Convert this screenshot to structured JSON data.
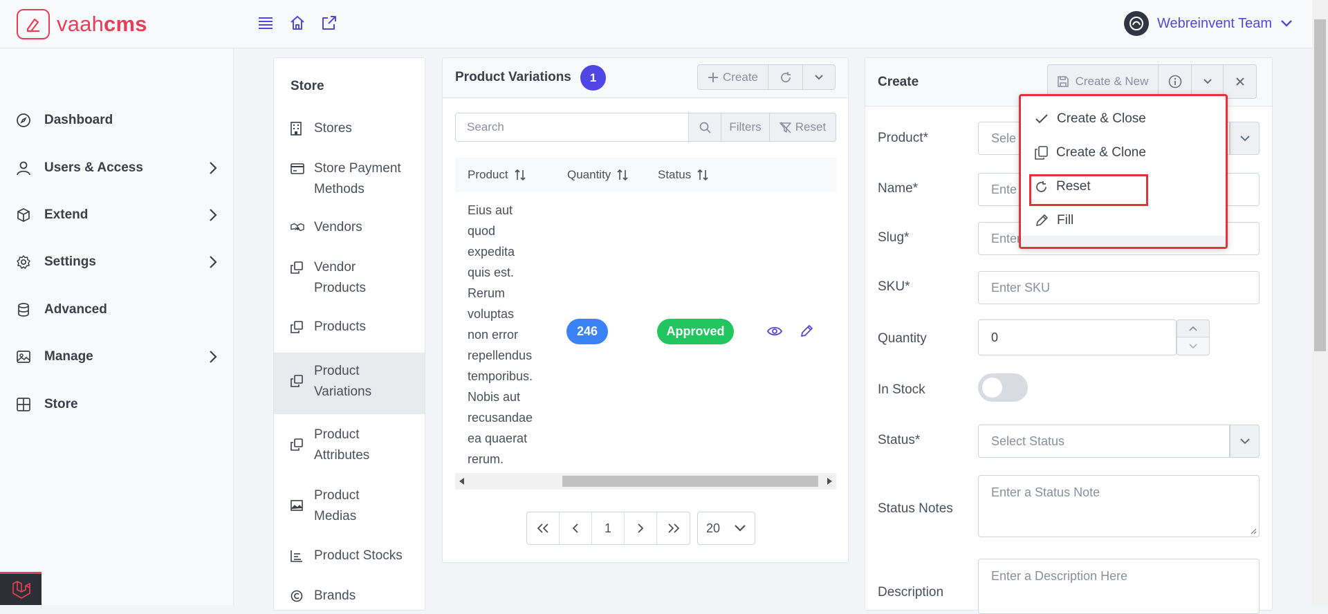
{
  "app": {
    "logo_text_a": "vaah",
    "logo_text_b": "cms"
  },
  "header": {
    "user_name": "Webreinvent Team"
  },
  "sidebar": {
    "items": [
      {
        "label": "Dashboard",
        "icon": "compass-icon",
        "has_chevron": false
      },
      {
        "label": "Users & Access",
        "icon": "user-icon",
        "has_chevron": true
      },
      {
        "label": "Extend",
        "icon": "cube-icon",
        "has_chevron": true
      },
      {
        "label": "Settings",
        "icon": "gear-icon",
        "has_chevron": true
      },
      {
        "label": "Advanced",
        "icon": "database-icon",
        "has_chevron": false
      },
      {
        "label": "Manage",
        "icon": "image-icon",
        "has_chevron": true
      },
      {
        "label": "Store",
        "icon": "grid-icon",
        "has_chevron": false
      }
    ]
  },
  "store_nav": {
    "title": "Store",
    "items": [
      {
        "line1": "Stores",
        "line2": ""
      },
      {
        "line1": "Store Payment",
        "line2": "Methods"
      },
      {
        "line1": "Vendors",
        "line2": ""
      },
      {
        "line1": "Vendor",
        "line2": "Products"
      },
      {
        "line1": "Products",
        "line2": ""
      },
      {
        "line1": "Product",
        "line2": "Variations",
        "active": true
      },
      {
        "line1": "Product",
        "line2": "Attributes"
      },
      {
        "line1": "Product",
        "line2": "Medias"
      },
      {
        "line1": "Product Stocks",
        "line2": ""
      },
      {
        "line1": "Brands",
        "line2": ""
      }
    ]
  },
  "list": {
    "title": "Product Variations",
    "count": "1",
    "create_label": "Create",
    "search_placeholder": "Search",
    "filters_label": "Filters",
    "reset_label": "Reset",
    "columns": [
      "Product",
      "Quantity",
      "Status"
    ],
    "rows": [
      {
        "product_lines": [
          "Eius aut",
          "quod",
          "expedita",
          "quis est.",
          "Rerum",
          "voluptas",
          "non error",
          "repellendus",
          "temporibus.",
          "Nobis aut",
          "recusandae",
          "ea quaerat",
          "rerum."
        ],
        "quantity": "246",
        "status": "Approved"
      }
    ],
    "pagination": {
      "current_page": "1",
      "per_page": "20"
    }
  },
  "form": {
    "title": "Create",
    "save_label": "Create & New",
    "fields": {
      "product_label": "Product*",
      "product_placeholder": "Sele",
      "name_label": "Name*",
      "name_placeholder": "Ente",
      "slug_label": "Slug*",
      "slug_placeholder": "Enter",
      "sku_label": "SKU*",
      "sku_placeholder": "Enter SKU",
      "quantity_label": "Quantity",
      "quantity_value": "0",
      "in_stock_label": "In Stock",
      "status_label": "Status*",
      "status_placeholder": "Select Status",
      "status_notes_label": "Status Notes",
      "status_notes_placeholder": "Enter a Status Note",
      "description_label": "Description",
      "description_placeholder": "Enter a Description Here"
    }
  },
  "dropdown_menu": {
    "items": [
      {
        "label": "Create & Close",
        "icon": "check-icon"
      },
      {
        "label": "Create & Clone",
        "icon": "copy-icon"
      },
      {
        "label": "Reset",
        "icon": "refresh-icon",
        "highlighted": true
      },
      {
        "label": "Fill",
        "icon": "pencil-icon"
      }
    ]
  },
  "colors": {
    "brand": "#e64059",
    "accent": "#4f46e5",
    "quantity_badge": "#3b82f6",
    "status_badge": "#22c55e",
    "highlight_box": "#e3333a"
  }
}
